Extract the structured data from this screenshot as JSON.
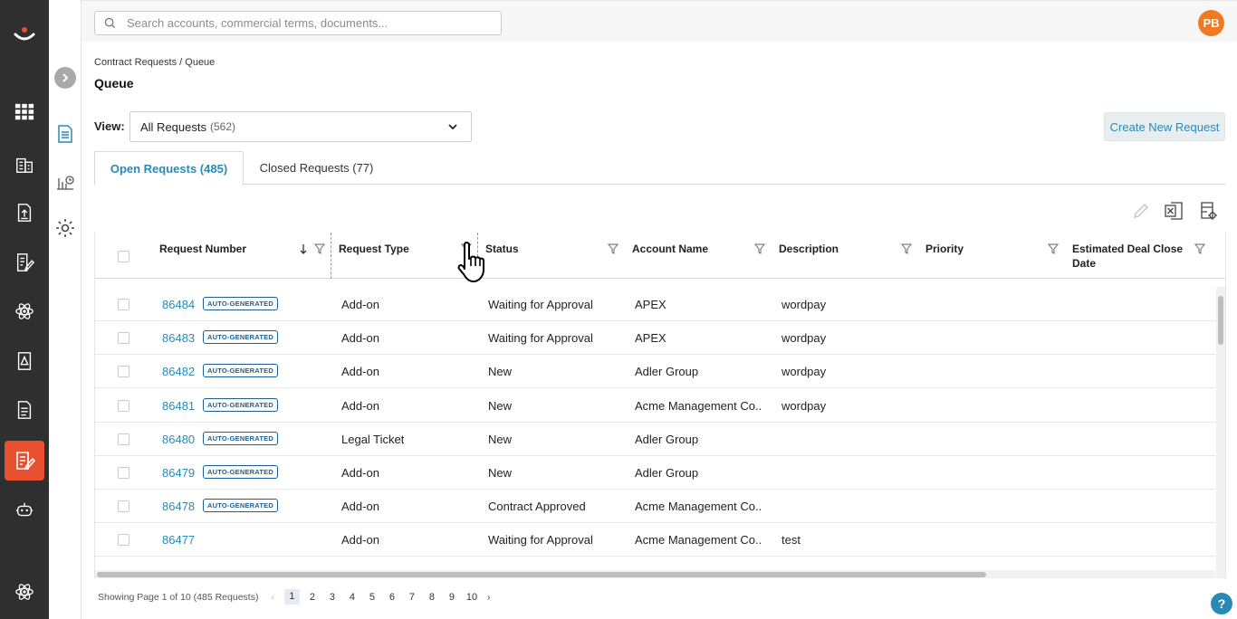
{
  "search": {
    "placeholder": "Search accounts, commercial terms, documents..."
  },
  "user": {
    "initials": "PB"
  },
  "breadcrumb": "Contract Requests / Queue",
  "page_title": "Queue",
  "view": {
    "label": "View:",
    "selected": "All Requests",
    "count": "(562)"
  },
  "create_button": "Create New Request",
  "tabs": [
    {
      "label": "Open Requests (485)",
      "active": true
    },
    {
      "label": "Closed Requests (77)",
      "active": false
    }
  ],
  "columns": {
    "request_number": "Request Number",
    "request_type": "Request Type",
    "status": "Status",
    "account_name": "Account Name",
    "description": "Description",
    "priority": "Priority",
    "close_date": "Estimated Deal Close Date"
  },
  "badge_text": "AUTO-GENERATED",
  "rows": [
    {
      "number": "86484",
      "auto": true,
      "type": "Add-on",
      "status": "Waiting for Approval",
      "account": "APEX",
      "description": "wordpay"
    },
    {
      "number": "86483",
      "auto": true,
      "type": "Add-on",
      "status": "Waiting for Approval",
      "account": "APEX",
      "description": "wordpay"
    },
    {
      "number": "86482",
      "auto": true,
      "type": "Add-on",
      "status": "New",
      "account": "Adler Group",
      "description": "wordpay"
    },
    {
      "number": "86481",
      "auto": true,
      "type": "Add-on",
      "status": "New",
      "account": "Acme Management Co...",
      "description": "wordpay"
    },
    {
      "number": "86480",
      "auto": true,
      "type": "Legal Ticket",
      "status": "New",
      "account": "Adler Group",
      "description": ""
    },
    {
      "number": "86479",
      "auto": true,
      "type": "Add-on",
      "status": "New",
      "account": "Adler Group",
      "description": ""
    },
    {
      "number": "86478",
      "auto": true,
      "type": "Add-on",
      "status": "Contract Approved",
      "account": "Acme Management Co...",
      "description": ""
    },
    {
      "number": "86477",
      "auto": false,
      "type": "Add-on",
      "status": "Waiting for Approval",
      "account": "Acme Management Co...",
      "description": "test"
    }
  ],
  "pagination": {
    "summary": "Showing Page 1 of 10 (485 Requests)",
    "pages": [
      "1",
      "2",
      "3",
      "4",
      "5",
      "6",
      "7",
      "8",
      "9",
      "10"
    ],
    "current": "1"
  },
  "help": "?"
}
